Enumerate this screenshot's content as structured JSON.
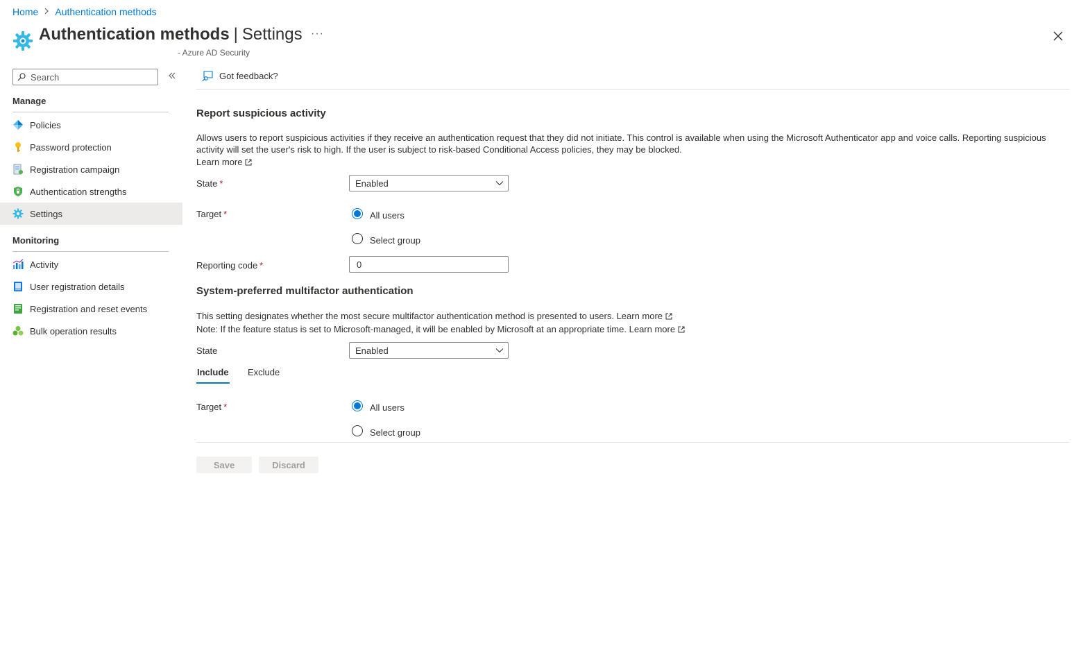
{
  "breadcrumb": {
    "home": "Home",
    "current": "Authentication methods"
  },
  "header": {
    "title_main": "Authentication methods",
    "title_separator": "|",
    "title_sub": "Settings",
    "more_label": "···",
    "subtitle": "- Azure AD Security"
  },
  "sidebar": {
    "search_placeholder": "Search",
    "manage_heading": "Manage",
    "manage_items": [
      {
        "label": "Policies",
        "icon": "policies-icon"
      },
      {
        "label": "Password protection",
        "icon": "key-icon"
      },
      {
        "label": "Registration campaign",
        "icon": "campaign-icon"
      },
      {
        "label": "Authentication strengths",
        "icon": "shield-icon"
      },
      {
        "label": "Settings",
        "icon": "gear-icon",
        "selected": true
      }
    ],
    "monitoring_heading": "Monitoring",
    "monitoring_items": [
      {
        "label": "Activity",
        "icon": "bar-chart-icon"
      },
      {
        "label": "User registration details",
        "icon": "user-details-icon"
      },
      {
        "label": "Registration and reset events",
        "icon": "events-icon"
      },
      {
        "label": "Bulk operation results",
        "icon": "bulk-icon"
      }
    ]
  },
  "command_bar": {
    "feedback_label": "Got feedback?"
  },
  "report_section": {
    "title": "Report suspicious activity",
    "description": "Allows users to report suspicious activities if they receive an authentication request that they did not initiate. This control is available when using the Microsoft Authenticator app and voice calls. Reporting suspicious activity will set the user's risk to high. If the user is subject to risk-based Conditional Access policies, they may be blocked.",
    "learn_more": "Learn more",
    "state_label": "State",
    "state_value": "Enabled",
    "target_label": "Target",
    "target_all": "All users",
    "target_group": "Select group",
    "reporting_code_label": "Reporting code",
    "reporting_code_value": "0",
    "required_mark": "*"
  },
  "mfa_section": {
    "title": "System-preferred multifactor authentication",
    "line1": "This setting designates whether the most secure multifactor authentication method is presented to users.",
    "line1_link": "Learn more",
    "line2": "Note: If the feature status is set to Microsoft-managed, it will be enabled by Microsoft at an appropriate time.",
    "line2_link": "Learn more",
    "state_label": "State",
    "state_value": "Enabled",
    "tab_include": "Include",
    "tab_exclude": "Exclude",
    "target_label": "Target",
    "target_all": "All users",
    "target_group": "Select group",
    "required_mark": "*"
  },
  "footer": {
    "save_label": "Save",
    "discard_label": "Discard"
  },
  "colors": {
    "accent": "#0078d4",
    "selected_nav": "#edebe9",
    "required": "#a4262c"
  }
}
